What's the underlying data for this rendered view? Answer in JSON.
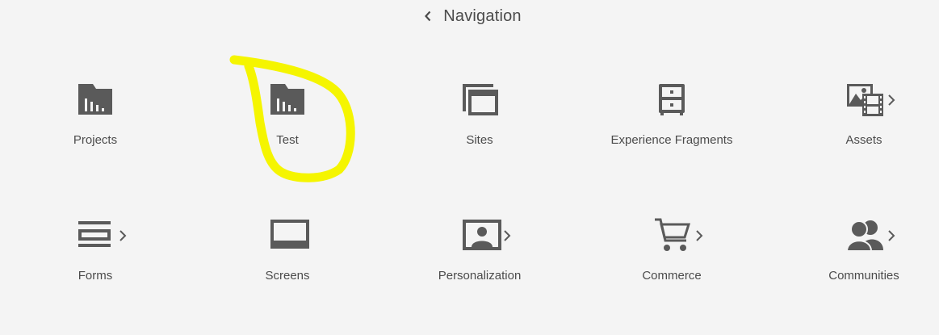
{
  "header": {
    "title": "Navigation",
    "back_icon": "chevron-left-icon"
  },
  "tiles": [
    {
      "label": "Projects",
      "icon": "projects-folder-icon",
      "has_submenu": false
    },
    {
      "label": "Test",
      "icon": "projects-folder-icon",
      "has_submenu": false
    },
    {
      "label": "Sites",
      "icon": "sites-icon",
      "has_submenu": false
    },
    {
      "label": "Experience Fragments",
      "icon": "cabinet-icon",
      "has_submenu": false
    },
    {
      "label": "Assets",
      "icon": "assets-icon",
      "has_submenu": true
    },
    {
      "label": "Forms",
      "icon": "forms-icon",
      "has_submenu": true
    },
    {
      "label": "Screens",
      "icon": "screens-icon",
      "has_submenu": false
    },
    {
      "label": "Personalization",
      "icon": "personalization-icon",
      "has_submenu": true
    },
    {
      "label": "Commerce",
      "icon": "cart-icon",
      "has_submenu": true
    },
    {
      "label": "Communities",
      "icon": "users-icon",
      "has_submenu": true
    }
  ],
  "annotation": {
    "color": "#f5f500",
    "shape": "hand-drawn-loop"
  },
  "colors": {
    "background": "#f4f4f4",
    "icon": "#5a5a5a",
    "text": "#4b4b4b"
  }
}
